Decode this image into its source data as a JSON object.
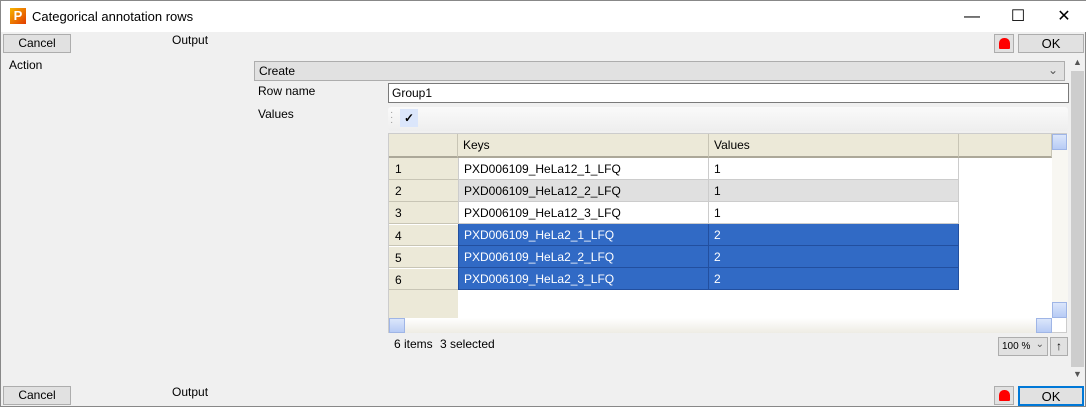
{
  "window": {
    "title": "Categorical annotation rows",
    "icon": "P",
    "minimize": "—",
    "maximize": "☐",
    "close": "✕"
  },
  "top_bar": {
    "cancel": "Cancel",
    "output": "Output",
    "ok": "OK"
  },
  "bottom_bar": {
    "cancel": "Cancel",
    "output": "Output",
    "ok": "OK"
  },
  "form": {
    "action_label": "Action",
    "action_value": "Create",
    "row_name_label": "Row name",
    "row_name_value": "Group1",
    "values_label": "Values",
    "check": "✓"
  },
  "table": {
    "columns": [
      "Keys",
      "Values"
    ],
    "rows": [
      {
        "num": "1",
        "key": "PXD006109_HeLa12_1_LFQ",
        "value": "1",
        "selected": false
      },
      {
        "num": "2",
        "key": "PXD006109_HeLa12_2_LFQ",
        "value": "1",
        "selected": false
      },
      {
        "num": "3",
        "key": "PXD006109_HeLa12_3_LFQ",
        "value": "1",
        "selected": false
      },
      {
        "num": "4",
        "key": "PXD006109_HeLa2_1_LFQ",
        "value": "2",
        "selected": true
      },
      {
        "num": "5",
        "key": "PXD006109_HeLa2_2_LFQ",
        "value": "2",
        "selected": true
      },
      {
        "num": "6",
        "key": "PXD006109_HeLa2_3_LFQ",
        "value": "2",
        "selected": true
      }
    ]
  },
  "status": {
    "items": "6 items",
    "selected": "3 selected",
    "zoom": "100 %",
    "up": "↑"
  }
}
